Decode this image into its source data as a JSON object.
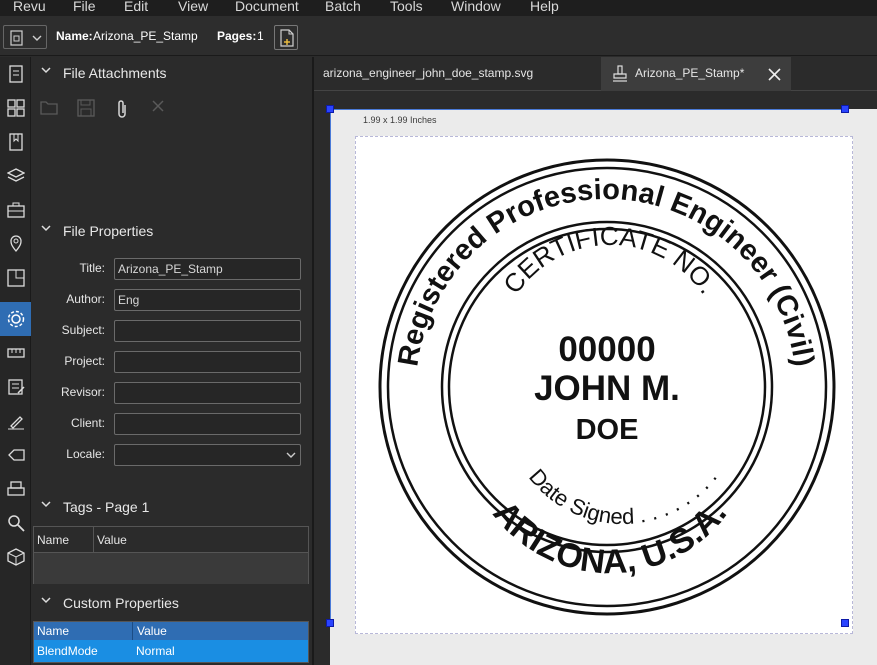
{
  "menu": [
    "Revu",
    "File",
    "Edit",
    "View",
    "Document",
    "Batch",
    "Tools",
    "Window",
    "Help"
  ],
  "toolbar": {
    "name_label": "Name:",
    "name_value": "Arizona_PE_Stamp",
    "pages_label": "Pages:",
    "pages_value": "1"
  },
  "panel": {
    "attachments_title": "File Attachments",
    "properties_title": "File Properties",
    "fields": [
      {
        "label": "Title:",
        "value": "Arizona_PE_Stamp"
      },
      {
        "label": "Author:",
        "value": "Eng"
      },
      {
        "label": "Subject:",
        "value": ""
      },
      {
        "label": "Project:",
        "value": ""
      },
      {
        "label": "Revisor:",
        "value": ""
      },
      {
        "label": "Client:",
        "value": ""
      },
      {
        "label": "Locale:",
        "value": ""
      }
    ],
    "tags_title": "Tags - Page 1",
    "tags_columns": [
      "Name",
      "Value"
    ],
    "custom_title": "Custom Properties",
    "custom_columns": [
      "Name",
      "Value"
    ],
    "custom_rows": [
      {
        "name": "BlendMode",
        "value": "Normal"
      }
    ]
  },
  "tabs": [
    {
      "label": "arizona_engineer_john_doe_stamp.svg"
    },
    {
      "label": "Arizona_PE_Stamp*"
    }
  ],
  "canvas": {
    "dimension_label": "1.99 x 1.99 Inches"
  },
  "stamp": {
    "outer_text": "Registered Professional Engineer (Civil)",
    "inner_text": "CERTIFICATE NO.",
    "number": "00000",
    "first_name": "JOHN M.",
    "last_name": "DOE",
    "date_text": "Date Signed . . . . . . . .",
    "bottom_text": "ARIZONA, U.S.A."
  },
  "colors": {
    "accent": "#2f6db3",
    "selected_row": "#1a8ee3",
    "handle": "#2a44ff"
  }
}
